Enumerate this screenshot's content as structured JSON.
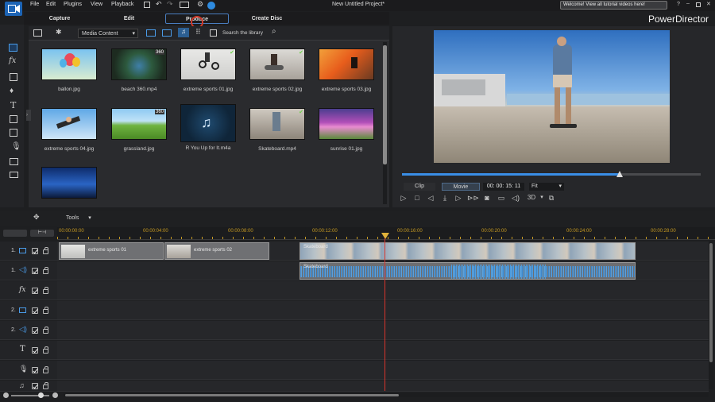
{
  "app": {
    "title": "New Untitled Project*",
    "name": "PowerDirector",
    "notification": "Welcome! View all tutorial videos here!"
  },
  "menu": [
    "File",
    "Edit",
    "Plugins",
    "View",
    "Playback"
  ],
  "tabs": [
    "Capture",
    "Edit",
    "Produce",
    "Create Disc"
  ],
  "active_tab": "Produce",
  "library": {
    "filter": "Media Content",
    "search_placeholder": "Search the library",
    "items": [
      {
        "label": "ballon.jpg",
        "badge": ""
      },
      {
        "label": "beach 360.mp4",
        "badge": "360"
      },
      {
        "label": "extreme sports 01.jpg",
        "badge": "check"
      },
      {
        "label": "extreme sports 02.jpg",
        "badge": "check"
      },
      {
        "label": "extreme sports 03.jpg",
        "badge": ""
      },
      {
        "label": "extreme sports 04.jpg",
        "badge": ""
      },
      {
        "label": "grassland.jpg",
        "badge": "360"
      },
      {
        "label": "R You Up for It.m4a",
        "badge": ""
      },
      {
        "label": "Skateboard.mp4",
        "badge": "check"
      },
      {
        "label": "sunrise 01.jpg",
        "badge": ""
      },
      {
        "label": "",
        "badge": ""
      }
    ]
  },
  "preview": {
    "mode_clip": "Clip",
    "mode_movie": "Movie",
    "timecode": "00: 00: 15: 11",
    "fit": "Fit",
    "label_3d": "3D",
    "progress": 0.73
  },
  "timeline": {
    "tools": "Tools",
    "ruler": [
      "00:00:00:00",
      "00:00:04:00",
      "00:00:08:00",
      "00:00:12:00",
      "00:00:16:00",
      "00:00:20:00",
      "00:00:24:00",
      "00:00:28:00"
    ],
    "tracks": [
      {
        "label": "1.",
        "type": "video"
      },
      {
        "label": "1.",
        "type": "audio"
      },
      {
        "label": "fx",
        "type": "fx"
      },
      {
        "label": "2.",
        "type": "video"
      },
      {
        "label": "2.",
        "type": "audio"
      },
      {
        "label": "T",
        "type": "title"
      },
      {
        "label": "",
        "type": "voice"
      },
      {
        "label": "",
        "type": "music"
      }
    ],
    "clips": {
      "clip1": "extreme sports 01",
      "clip2": "extreme sports 02",
      "clip3": "Skateboard",
      "clip3_audio": "Skateboard"
    }
  },
  "colors": {
    "accent": "#3a8ee6",
    "playhead": "#d9342b",
    "ruler_text": "#c79a22"
  }
}
